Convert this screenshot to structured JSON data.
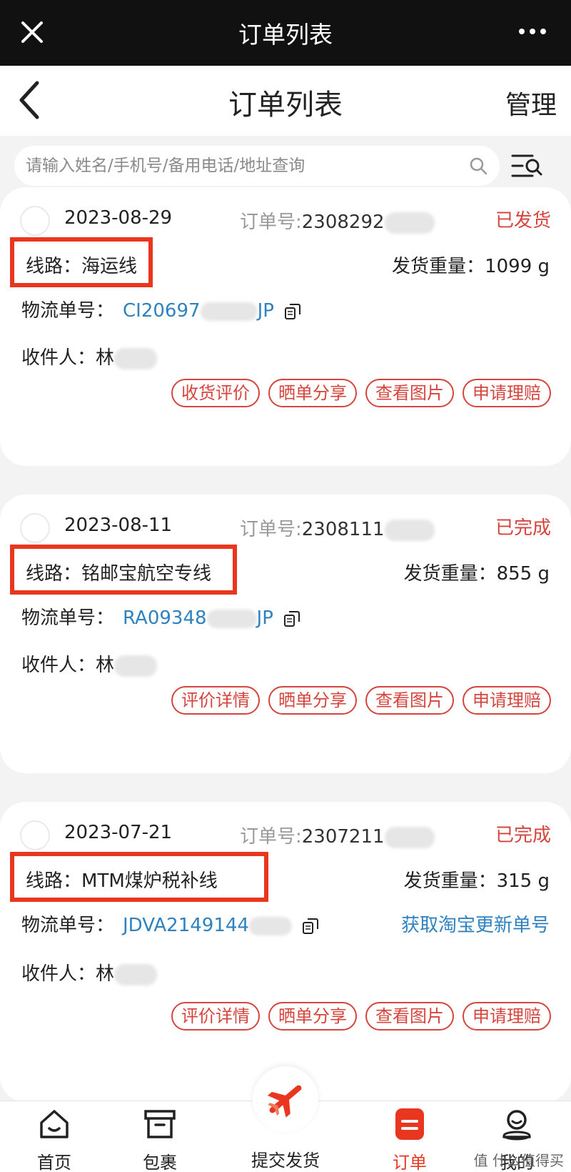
{
  "top_bar": {
    "title": "订单列表"
  },
  "nav": {
    "title": "订单列表",
    "manage_label": "管理"
  },
  "search": {
    "placeholder": "请输入姓名/手机号/备用电话/地址查询"
  },
  "orders": [
    {
      "date": "2023-08-29",
      "order_label": "订单号:",
      "order_no": "2308292",
      "status": "已发货",
      "route_label": "线路：",
      "route": "海运线",
      "weight_label": "发货重量：",
      "weight": "1099 g",
      "tracking_label": "物流单号：",
      "tracking_start": "CI20697",
      "tracking_end": "JP",
      "recipient_label": "收件人：",
      "recipient": "林",
      "actions": [
        "收货评价",
        "晒单分享",
        "查看图片",
        "申请理赔"
      ]
    },
    {
      "date": "2023-08-11",
      "order_label": "订单号:",
      "order_no": "2308111",
      "status": "已完成",
      "route_label": "线路：",
      "route": "铭邮宝航空专线",
      "weight_label": "发货重量：",
      "weight": "855 g",
      "tracking_label": "物流单号：",
      "tracking_start": "RA09348",
      "tracking_end": "JP",
      "recipient_label": "收件人：",
      "recipient": "林",
      "actions": [
        "评价详情",
        "晒单分享",
        "查看图片",
        "申请理赔"
      ]
    },
    {
      "date": "2023-07-21",
      "order_label": "订单号:",
      "order_no": "2307211",
      "status": "已完成",
      "route_label": "线路：",
      "route": "MTM煤炉税补线",
      "weight_label": "发货重量：",
      "weight": "315 g",
      "tracking_label": "物流单号：",
      "tracking_start": "JDVA2149144",
      "tracking_end": "",
      "extra_link": "获取淘宝更新单号",
      "recipient_label": "收件人：",
      "recipient": "林",
      "actions": [
        "评价详情",
        "晒单分享",
        "查看图片",
        "申请理赔"
      ]
    }
  ],
  "tabs": [
    {
      "label": "首页",
      "icon": "home-icon"
    },
    {
      "label": "包裹",
      "icon": "package-icon"
    },
    {
      "label": "提交发货",
      "icon": "plane-icon"
    },
    {
      "label": "订单",
      "icon": "order-icon"
    },
    {
      "label": "我的",
      "icon": "profile-icon"
    }
  ],
  "watermark": "值 什么值得买",
  "colors": {
    "accent": "#e8361f",
    "status": "#d6453d",
    "link": "#2f82c0"
  }
}
